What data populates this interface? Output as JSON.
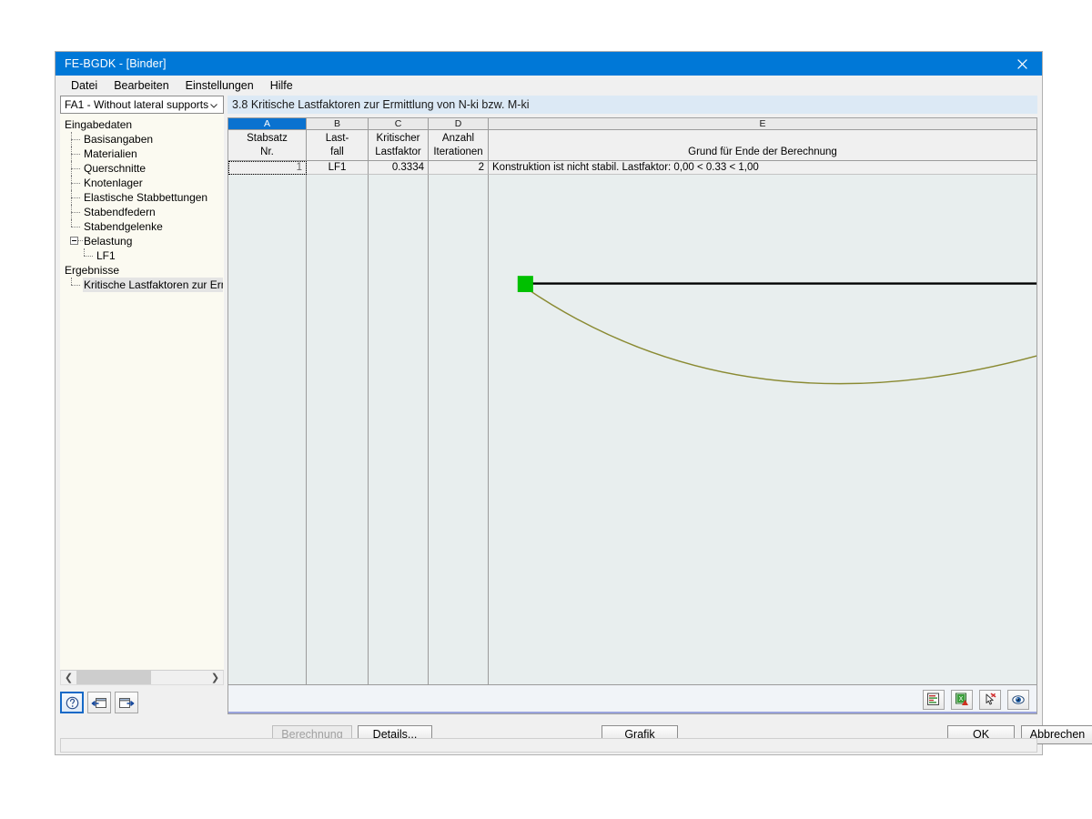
{
  "window": {
    "title": "FE-BGDK - [Binder]",
    "close_icon": "close-icon"
  },
  "menu": {
    "items": [
      {
        "label": "Datei"
      },
      {
        "label": "Bearbeiten"
      },
      {
        "label": "Einstellungen"
      },
      {
        "label": "Hilfe"
      }
    ]
  },
  "sidebar": {
    "selector": {
      "value": "FA1 - Without lateral supports",
      "chevron_icon": "chevron-down-icon"
    },
    "tree": [
      {
        "label": "Eingabedaten",
        "level": 0,
        "type": "root",
        "selected": false
      },
      {
        "label": "Basisangaben",
        "level": 1,
        "type": "leaf",
        "selected": false
      },
      {
        "label": "Materialien",
        "level": 1,
        "type": "leaf",
        "selected": false
      },
      {
        "label": "Querschnitte",
        "level": 1,
        "type": "leaf",
        "selected": false
      },
      {
        "label": "Knotenlager",
        "level": 1,
        "type": "leaf",
        "selected": false
      },
      {
        "label": "Elastische Stabbettungen",
        "level": 1,
        "type": "leaf",
        "selected": false
      },
      {
        "label": "Stabendfedern",
        "level": 1,
        "type": "leaf",
        "selected": false
      },
      {
        "label": "Stabendgelenke",
        "level": 1,
        "type": "leaf",
        "selected": false
      },
      {
        "label": "Belastung",
        "level": 1,
        "type": "branch",
        "selected": false
      },
      {
        "label": "LF1",
        "level": 2,
        "type": "leaf",
        "selected": false
      },
      {
        "label": "Ergebnisse",
        "level": 0,
        "type": "root",
        "selected": false
      },
      {
        "label": "Kritische Lastfaktoren zur Ermit",
        "level": 1,
        "type": "leaf",
        "selected": true
      }
    ],
    "scrollbar": {
      "left_arrow": "❮",
      "right_arrow": "❯"
    },
    "toolbar": [
      {
        "name": "help-info-button",
        "icon": "question-mark-icon",
        "focused": true
      },
      {
        "name": "previous-button",
        "icon": "arrow-left-icon",
        "focused": false
      },
      {
        "name": "next-button",
        "icon": "arrow-right-icon",
        "focused": false
      }
    ]
  },
  "content": {
    "section_title": "3.8 Kritische Lastfaktoren zur Ermittlung von N-ki bzw. M-ki",
    "table": {
      "column_letters": [
        "A",
        "B",
        "C",
        "D",
        "E"
      ],
      "active_column": "A",
      "headers": [
        {
          "line1": "Stabsatz",
          "line2": "Nr."
        },
        {
          "line1": "Last-",
          "line2": "fall"
        },
        {
          "line1": "Kritischer",
          "line2": "Lastfaktor"
        },
        {
          "line1": "Anzahl",
          "line2": "Iterationen"
        },
        {
          "line1": "",
          "line2": "Grund für Ende der Berechnung"
        }
      ],
      "rows": [
        {
          "a": "1",
          "b": "LF1",
          "c": "0.3334",
          "d": "2",
          "e": "Konstruktion ist nicht stabil. Lastfaktor: 0,00 < 0.33 < 1,00"
        }
      ]
    },
    "graphic": {
      "description": "beam-buckling-mode-shape",
      "beam_color": "#000000",
      "mode_shape_color": "#8a8a32",
      "support_color": "#00c000"
    },
    "view_tools": [
      {
        "name": "print-report-icon",
        "icon": "report-icon"
      },
      {
        "name": "export-excel-icon",
        "icon": "excel-export-icon"
      },
      {
        "name": "select-pointer-icon",
        "icon": "pointer-pin-icon"
      },
      {
        "name": "visibility-eye-icon",
        "icon": "eye-icon"
      }
    ]
  },
  "footer": {
    "buttons": [
      {
        "name": "calculate-button",
        "label": "Berechnung",
        "disabled": true
      },
      {
        "name": "details-button",
        "label": "Details...",
        "disabled": false
      },
      {
        "name": "graphic-button",
        "label": "Grafik",
        "disabled": false
      },
      {
        "name": "ok-button",
        "label": "OK",
        "disabled": false
      },
      {
        "name": "cancel-button",
        "label": "Abbrechen",
        "disabled": false
      }
    ]
  }
}
